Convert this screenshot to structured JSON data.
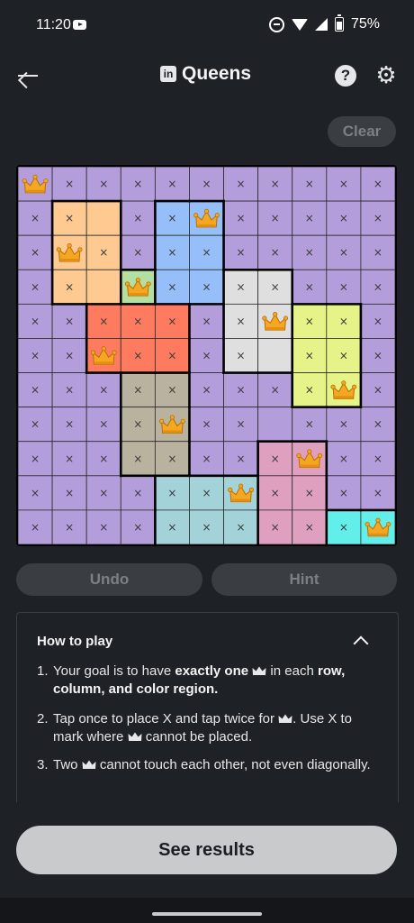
{
  "status_bar": {
    "time": "11:20",
    "battery": "75%"
  },
  "app_bar": {
    "title": "Queens",
    "logo_text": "in"
  },
  "controls": {
    "clear": "Clear",
    "undo": "Undo",
    "hint": "Hint",
    "see_results": "See results"
  },
  "board": {
    "size": 11,
    "colors": {
      "purple": "#b39ddb",
      "orange": "#ffc992",
      "blue": "#96bef9",
      "green": "#b3dfa0",
      "white": "#dfdfdf",
      "red": "#ff7b60",
      "yellow": "#e6f388",
      "gray": "#b9b29e",
      "pink": "#dfa0bf",
      "teal": "#a3d2d8",
      "cyan": "#62efea"
    },
    "regions": [
      "PPPPPPPPPPP",
      "POOPBBPPPPP",
      "POOPBBPPPPP",
      "POOGBBWWPPP",
      "PPRRRPWWYYP",
      "PPRRRPWWYYP",
      "PPPAAPPPYYP",
      "PPPAAPPPPPP",
      "PPPAAPPKKPP",
      "PPPPTTTKKPP",
      "PPPPTTTKKCC"
    ],
    "queens": [
      [
        0,
        0
      ],
      [
        1,
        5
      ],
      [
        2,
        1
      ],
      [
        3,
        3
      ],
      [
        4,
        7
      ],
      [
        5,
        2
      ],
      [
        6,
        9
      ],
      [
        7,
        4
      ],
      [
        8,
        8
      ],
      [
        9,
        6
      ],
      [
        10,
        10
      ]
    ],
    "empty_cells": [
      [
        1,
        2
      ],
      [
        3,
        2
      ],
      [
        5,
        7
      ],
      [
        7,
        7
      ]
    ],
    "x_mark": "×"
  },
  "how_to_play": {
    "title": "How to play",
    "rule1": {
      "num": "1.",
      "pre": "Your goal is to have ",
      "bold1": "exactly one",
      "mid": " in each ",
      "bold2": "row, column, and color region."
    },
    "rule2": {
      "num": "2.",
      "pre": "Tap once to place X and tap twice for",
      "mid": ". Use X to mark where",
      "post": " cannot be placed."
    },
    "rule3": {
      "num": "3.",
      "pre": "Two",
      "post": " cannot touch each other, not even diagonally."
    }
  },
  "icons": {
    "back": "arrow-left-icon",
    "help": "help-circle-icon",
    "settings": "gear-icon",
    "collapse": "chevron-up-icon",
    "queen": "crown-icon"
  }
}
